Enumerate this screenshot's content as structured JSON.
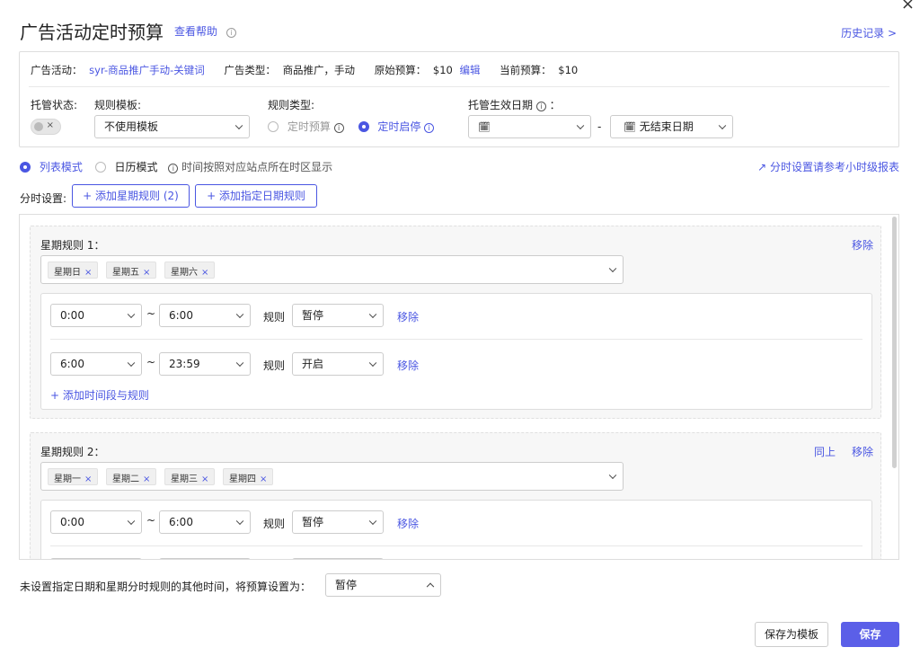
{
  "header": {
    "title": "广告活动定时预算",
    "help": "查看帮助",
    "history": "历史记录 >",
    "close": "×"
  },
  "campaign_info": {
    "campaign_label": "广告活动：",
    "campaign_value": "syr-商品推广手动-关键词",
    "type_label": "广告类型：",
    "type_value": "商品推广，手动",
    "orig_budget_label": "原始预算：",
    "orig_budget_value": "$10",
    "edit": "编辑",
    "cur_budget_label": "当前预算：",
    "cur_budget_value": "$10"
  },
  "settings": {
    "managed_status_label": "托管状态:",
    "toggle_x": "×",
    "template_label": "规则模板:",
    "template_value": "不使用模板",
    "rule_type_label": "规则类型:",
    "rule_type_options": [
      "定时预算",
      "定时启停"
    ],
    "rule_type_selected": "定时启停",
    "effective_date_label": "托管生效日期",
    "effective_date_suffix": "：",
    "start_date": "",
    "dash": "-",
    "end_date": "无结束日期"
  },
  "mode": {
    "list_mode": "列表模式",
    "calendar_mode": "日历模式",
    "timezone_note": "时间按照对应站点所在时区显示",
    "report_link": "分时设置请参考小时级报表"
  },
  "time_settings": {
    "label": "分时设置:",
    "add_weekly": "+ 添加星期规则 (2)",
    "add_date": "+ 添加指定日期规则"
  },
  "rules": [
    {
      "title": "星期规则 1：",
      "actions": [
        "移除"
      ],
      "days": [
        "星期日",
        "星期五",
        "星期六"
      ],
      "periods": [
        {
          "start": "0:00",
          "end": "6:00",
          "rule_label": "规则",
          "rule": "暂停",
          "remove": "移除"
        },
        {
          "start": "6:00",
          "end": "23:59",
          "rule_label": "规则",
          "rule": "开启",
          "remove": "移除"
        }
      ],
      "add_period": "+ 添加时间段与规则"
    },
    {
      "title": "星期规则 2：",
      "actions": [
        "同上",
        "移除"
      ],
      "days": [
        "星期一",
        "星期二",
        "星期三",
        "星期四"
      ],
      "periods": [
        {
          "start": "0:00",
          "end": "6:00",
          "rule_label": "规则",
          "rule": "暂停",
          "remove": "移除"
        }
      ]
    }
  ],
  "tilde": "~",
  "footer": {
    "other_time_label": "未设置指定日期和星期分时规则的其他时间，将预算设置为：",
    "other_time_value": "暂停",
    "save_template": "保存为模板",
    "save": "保存"
  },
  "colors": {
    "accent": "#4a56e2",
    "primary_button": "#5b5fe8"
  }
}
